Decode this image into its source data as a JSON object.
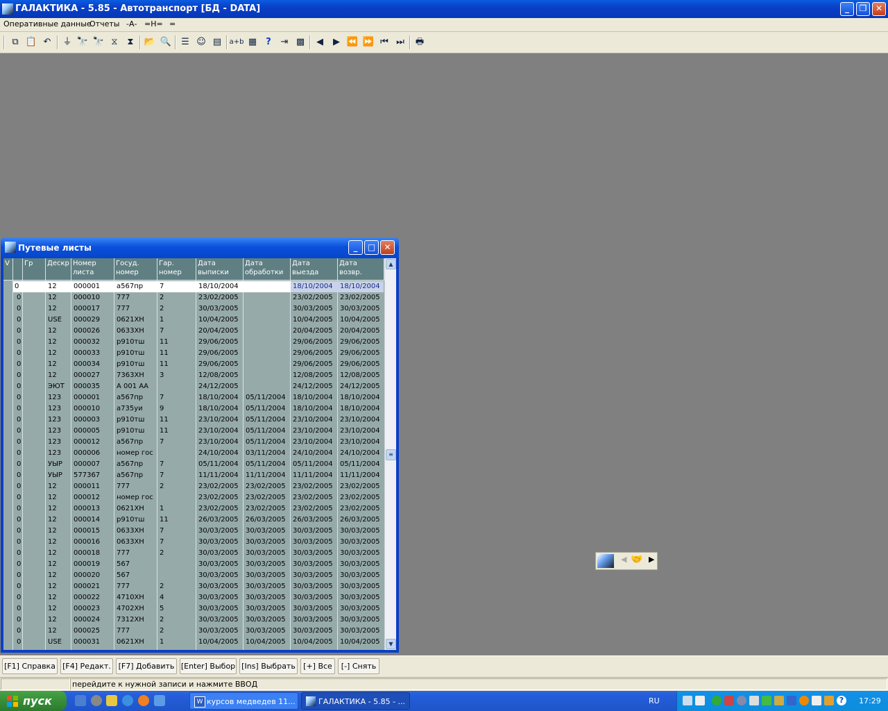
{
  "window": {
    "title": "ГАЛАКТИКА - 5.85 - Автотранспорт [БД - DATA]"
  },
  "menu": [
    "Оперативные данные",
    "Отчеты",
    "-А-",
    "=Н=",
    "="
  ],
  "toolbar_icons": [
    "copy-icon",
    "paste-icon",
    "undo-icon",
    "filter-icon",
    "find-icon",
    "find-next-icon",
    "filter-set-icon",
    "filter-clear-icon",
    "open-folder-icon",
    "search-folder-icon",
    "list-icon",
    "smiley-icon",
    "panel-icon",
    "text-ab-icon",
    "calculator-icon",
    "help-icon",
    "exit-icon",
    "grid-icon",
    "prev-icon",
    "next-icon",
    "rewind-icon",
    "fast-forward-icon",
    "first-icon",
    "last-icon",
    "print-icon"
  ],
  "child_window": {
    "title": "Путевые листы",
    "headers": [
      {
        "l1": "V",
        "l2": ""
      },
      {
        "l1": "",
        "l2": ""
      },
      {
        "l1": "Гр",
        "l2": ""
      },
      {
        "l1": "Дескр",
        "l2": ""
      },
      {
        "l1": "Номер",
        "l2": "листа"
      },
      {
        "l1": "Госуд.",
        "l2": "номер"
      },
      {
        "l1": "Гар.",
        "l2": "номер"
      },
      {
        "l1": "Дата",
        "l2": "выписки"
      },
      {
        "l1": "Дата",
        "l2": "обработки"
      },
      {
        "l1": "Дата",
        "l2": "выезда"
      },
      {
        "l1": "Дата",
        "l2": "возвр."
      }
    ],
    "rows": [
      [
        "0",
        "",
        "12",
        "000001",
        "а567пр",
        "7",
        "18/10/2004",
        "",
        "18/10/2004",
        "18/10/2004"
      ],
      [
        "0",
        "",
        "12",
        "000010",
        "777",
        "2",
        "23/02/2005",
        "",
        "23/02/2005",
        "23/02/2005"
      ],
      [
        "0",
        "",
        "12",
        "000017",
        "777",
        "2",
        "30/03/2005",
        "",
        "30/03/2005",
        "30/03/2005"
      ],
      [
        "0",
        "",
        "USE",
        "000029",
        "0621ХН",
        "1",
        "10/04/2005",
        "",
        "10/04/2005",
        "10/04/2005"
      ],
      [
        "0",
        "",
        "12",
        "000026",
        "0633ХН",
        "7",
        "20/04/2005",
        "",
        "20/04/2005",
        "20/04/2005"
      ],
      [
        "0",
        "",
        "12",
        "000032",
        "р910тш",
        "11",
        "29/06/2005",
        "",
        "29/06/2005",
        "29/06/2005"
      ],
      [
        "0",
        "",
        "12",
        "000033",
        "р910тш",
        "11",
        "29/06/2005",
        "",
        "29/06/2005",
        "29/06/2005"
      ],
      [
        "0",
        "",
        "12",
        "000034",
        "р910тш",
        "11",
        "29/06/2005",
        "",
        "29/06/2005",
        "29/06/2005"
      ],
      [
        "0",
        "",
        "12",
        "000027",
        "7363ХН",
        "3",
        "12/08/2005",
        "",
        "12/08/2005",
        "12/08/2005"
      ],
      [
        "0",
        "",
        "ЭЮТ",
        "000035",
        "А 001 АА",
        "",
        "24/12/2005",
        "",
        "24/12/2005",
        "24/12/2005"
      ],
      [
        "0",
        "",
        "123",
        "000001",
        "а567пр",
        "7",
        "18/10/2004",
        "05/11/2004",
        "18/10/2004",
        "18/10/2004"
      ],
      [
        "0",
        "",
        "123",
        "000010",
        "а735уи",
        "9",
        "18/10/2004",
        "05/11/2004",
        "18/10/2004",
        "18/10/2004"
      ],
      [
        "0",
        "",
        "123",
        "000003",
        "р910тш",
        "11",
        "23/10/2004",
        "05/11/2004",
        "23/10/2004",
        "23/10/2004"
      ],
      [
        "0",
        "",
        "123",
        "000005",
        "р910тш",
        "11",
        "23/10/2004",
        "05/11/2004",
        "23/10/2004",
        "23/10/2004"
      ],
      [
        "0",
        "",
        "123",
        "000012",
        "а567пр",
        "7",
        "23/10/2004",
        "05/11/2004",
        "23/10/2004",
        "23/10/2004"
      ],
      [
        "0",
        "",
        "123",
        "000006",
        "номер гос",
        "",
        "24/10/2004",
        "03/11/2004",
        "24/10/2004",
        "24/10/2004"
      ],
      [
        "0",
        "",
        "УЫР",
        "000007",
        "а567пр",
        "7",
        "05/11/2004",
        "05/11/2004",
        "05/11/2004",
        "05/11/2004"
      ],
      [
        "0",
        "",
        "УЫР",
        "577367",
        "а567пр",
        "7",
        "11/11/2004",
        "11/11/2004",
        "11/11/2004",
        "11/11/2004"
      ],
      [
        "0",
        "",
        "12",
        "000011",
        "777",
        "2",
        "23/02/2005",
        "23/02/2005",
        "23/02/2005",
        "23/02/2005"
      ],
      [
        "0",
        "",
        "12",
        "000012",
        "номер гос",
        "",
        "23/02/2005",
        "23/02/2005",
        "23/02/2005",
        "23/02/2005"
      ],
      [
        "0",
        "",
        "12",
        "000013",
        "0621ХН",
        "1",
        "23/02/2005",
        "23/02/2005",
        "23/02/2005",
        "23/02/2005"
      ],
      [
        "0",
        "",
        "12",
        "000014",
        "р910тш",
        "11",
        "26/03/2005",
        "26/03/2005",
        "26/03/2005",
        "26/03/2005"
      ],
      [
        "0",
        "",
        "12",
        "000015",
        "0633ХН",
        "7",
        "30/03/2005",
        "30/03/2005",
        "30/03/2005",
        "30/03/2005"
      ],
      [
        "0",
        "",
        "12",
        "000016",
        "0633ХН",
        "7",
        "30/03/2005",
        "30/03/2005",
        "30/03/2005",
        "30/03/2005"
      ],
      [
        "0",
        "",
        "12",
        "000018",
        "777",
        "2",
        "30/03/2005",
        "30/03/2005",
        "30/03/2005",
        "30/03/2005"
      ],
      [
        "0",
        "",
        "12",
        "000019",
        "567",
        "",
        "30/03/2005",
        "30/03/2005",
        "30/03/2005",
        "30/03/2005"
      ],
      [
        "0",
        "",
        "12",
        "000020",
        "567",
        "",
        "30/03/2005",
        "30/03/2005",
        "30/03/2005",
        "30/03/2005"
      ],
      [
        "0",
        "",
        "12",
        "000021",
        "777",
        "2",
        "30/03/2005",
        "30/03/2005",
        "30/03/2005",
        "30/03/2005"
      ],
      [
        "0",
        "",
        "12",
        "000022",
        "4710ХН",
        "4",
        "30/03/2005",
        "30/03/2005",
        "30/03/2005",
        "30/03/2005"
      ],
      [
        "0",
        "",
        "12",
        "000023",
        "4702ХН",
        "5",
        "30/03/2005",
        "30/03/2005",
        "30/03/2005",
        "30/03/2005"
      ],
      [
        "0",
        "",
        "12",
        "000024",
        "7312ХН",
        "2",
        "30/03/2005",
        "30/03/2005",
        "30/03/2005",
        "30/03/2005"
      ],
      [
        "0",
        "",
        "12",
        "000025",
        "777",
        "2",
        "30/03/2005",
        "30/03/2005",
        "30/03/2005",
        "30/03/2005"
      ],
      [
        "0",
        "",
        "USE",
        "000031",
        "0621ХН",
        "1",
        "10/04/2005",
        "10/04/2005",
        "10/04/2005",
        "10/04/2005"
      ]
    ]
  },
  "fkeys": [
    "[F1] Справка",
    "[F4] Редакт.",
    "[F7] Добавить",
    "[Enter] Выбор",
    "[Ins] Выбрать",
    "[+] Все",
    "[-] Снять"
  ],
  "status": {
    "hint": "перейдите к нужной записи и нажмите ВВОД"
  },
  "taskbar": {
    "start_label": "пуск",
    "tasks": [
      "курсов медведев 11...",
      "ГАЛАКТИКА - 5.85 - ..."
    ],
    "lang": "RU",
    "clock": "17:29"
  },
  "colors": {
    "grid_bg": "#96aaaa",
    "grid_header": "#5f7f82",
    "desktop": "#808080",
    "selection": "#c8d2e8"
  }
}
